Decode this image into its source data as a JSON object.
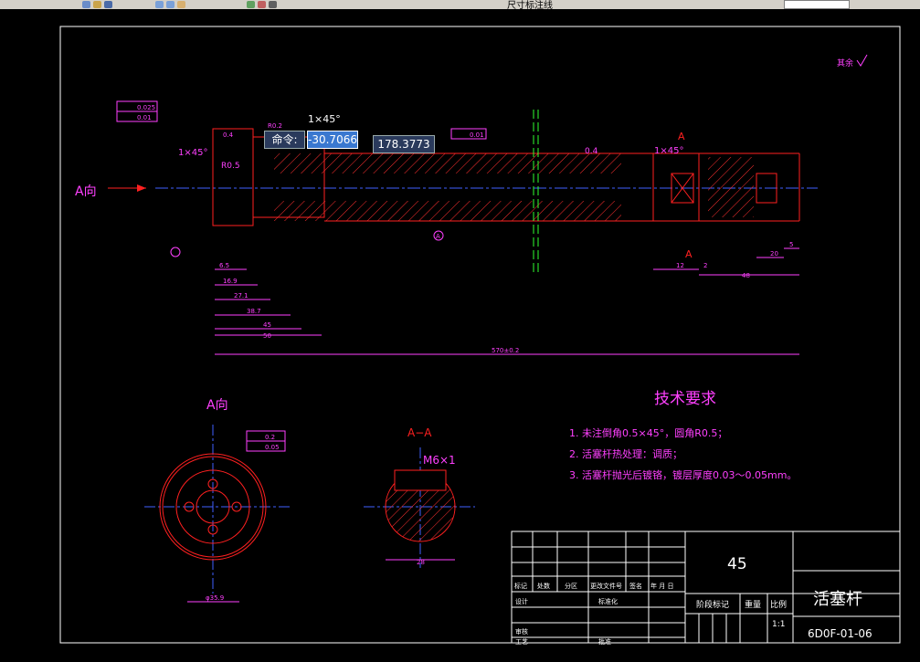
{
  "toolbar": {
    "layer_text": "尺寸标注线",
    "icons": [
      "new-icon",
      "open-icon",
      "save-icon",
      "zoom-in-icon",
      "zoom-out-icon",
      "pan-icon",
      "properties-icon",
      "layer-icon",
      "table-icon"
    ]
  },
  "command": {
    "label": "命令:",
    "value": "-30.7066",
    "coord": "178.3773"
  },
  "drawing": {
    "roughness_note": "其余",
    "direction_label": "A向",
    "section_label_top": "A",
    "section_label_bottom": "A",
    "chamfer_1": "1×45°",
    "chamfer_2": "1×45°",
    "chamfer_3": "1×45°",
    "radius_1": "R0.5",
    "radius_2": "R0.2",
    "roughness_1": "0.4",
    "roughness_2": "0.4",
    "tolerance_1": "0.025",
    "tolerance_2": "0.01",
    "tolerance_3": "0.01",
    "datum": "A",
    "dims_bottom": [
      "6.5",
      "16.9",
      "27.1",
      "38.7",
      "45",
      "50",
      "570±0.2"
    ],
    "dims_right": [
      "12",
      "2",
      "48",
      "20",
      "5"
    ],
    "view_a_label": "A向",
    "view_a_dim": "φ35.9",
    "view_a_tol": "0.2",
    "view_a_tol2": "0.05",
    "section_view_label": "A−A",
    "thread_label": "M6×1",
    "section_dim": "28",
    "tech_title": "技术要求",
    "tech_items": [
      "1. 未注倒角0.5×45°，圆角R0.5；",
      "2. 活塞杆热处理：调质；",
      "3. 活塞杆抛光后镀铬，镀层厚度0.03～0.05mm。"
    ]
  },
  "title_block": {
    "material": "45",
    "part_name": "活塞杆",
    "drawing_no": "6D0F-01-06",
    "row_labels": [
      "标记",
      "处数",
      "分区",
      "更改文件号",
      "签名",
      "年 月 日"
    ],
    "design": "设计",
    "standardize": "标准化",
    "review": "审核",
    "process": "工艺",
    "approve": "批准",
    "stage": "阶段标记",
    "weight": "重量",
    "scale_label": "比例",
    "scale": "1:1"
  }
}
